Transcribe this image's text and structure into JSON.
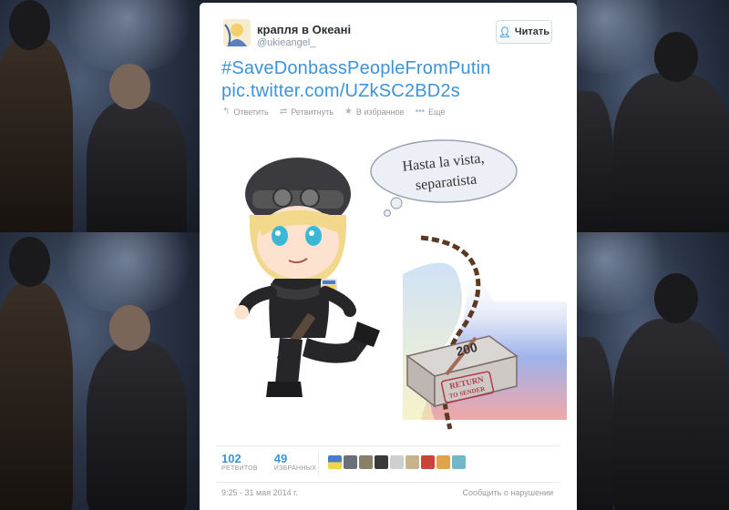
{
  "tweet": {
    "user_name": "крапля в Океані",
    "handle": "@ukieangel_",
    "follow_label": "Читать",
    "text_lines": [
      "#SaveDonbassPeopleFromPutin",
      "pic.twitter.com/UZkSC2BD2s"
    ],
    "actions": {
      "reply": "Ответить",
      "retweet": "Ретвитнуть",
      "favorite": "В избранное",
      "more": "Ещё"
    },
    "image": {
      "speech_line1": "Hasta la vista,",
      "speech_line2": "separatista",
      "box_number": "200",
      "box_label_line1": "RETURN",
      "box_label_line2": "TO SENDER"
    },
    "stats": {
      "retweets": "102",
      "retweets_label": "РЕТВИТОВ",
      "favorites": "49",
      "favorites_label": "ИЗБРАННЫХ"
    },
    "timestamp": "9:25 - 31 мая 2014 г.",
    "report_link": "Сообщить о нарушении"
  },
  "colors": {
    "link": "#3b94d9",
    "muted": "#999999",
    "text": "#292f33"
  },
  "icons": {
    "reply": "reply-arrow",
    "retweet": "retweet-arrows",
    "favorite": "star",
    "more": "ellipsis",
    "follow": "add-user"
  }
}
